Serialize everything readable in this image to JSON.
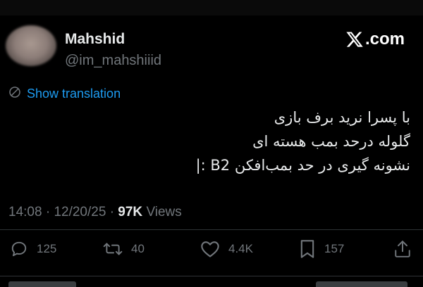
{
  "author": {
    "name": "Mahshid",
    "handle": "@im_mahshiiid"
  },
  "brand": {
    "text": ".com",
    "logo_icon": "x-logo-icon"
  },
  "translation": {
    "label": "Show translation",
    "icon": "globe-icon"
  },
  "tweet": {
    "lines": [
      "با پسرا نرید برف بازی",
      "گلوله درحد بمب هسته ای",
      "نشونه گیری در حد بمب‌افکن B2 :|"
    ]
  },
  "meta": {
    "time": "14:08",
    "separator": "·",
    "date": "12/20/25",
    "views_count": "97K",
    "views_label": "Views"
  },
  "actions": {
    "replies": {
      "count": "125",
      "icon": "reply-icon"
    },
    "reposts": {
      "count": "40",
      "icon": "repost-icon"
    },
    "likes": {
      "count": "4.4K",
      "icon": "heart-icon"
    },
    "bookmarks": {
      "count": "157",
      "icon": "bookmark-icon"
    },
    "share": {
      "icon": "share-icon"
    }
  },
  "colors": {
    "background": "#000000",
    "text_primary": "#e7e9ea",
    "text_secondary": "#71767b",
    "link": "#1d9bf0",
    "divider": "#2f3336"
  }
}
